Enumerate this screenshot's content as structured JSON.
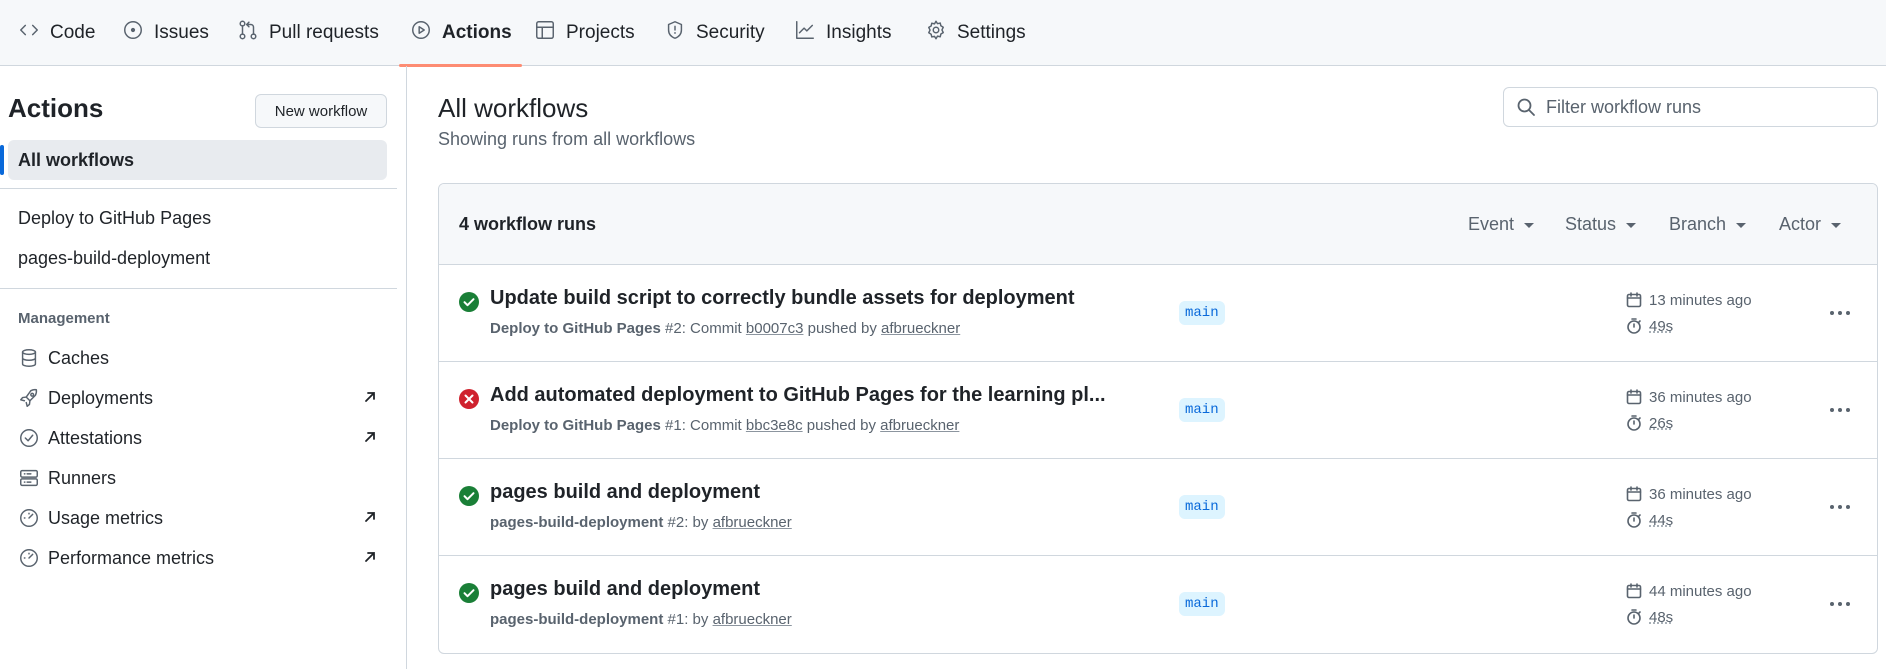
{
  "nav": {
    "tabs": [
      {
        "label": "Code",
        "icon": "code-icon"
      },
      {
        "label": "Issues",
        "icon": "issue-icon"
      },
      {
        "label": "Pull requests",
        "icon": "pull-request-icon"
      },
      {
        "label": "Actions",
        "icon": "play-icon",
        "active": true
      },
      {
        "label": "Projects",
        "icon": "table-icon"
      },
      {
        "label": "Security",
        "icon": "shield-icon"
      },
      {
        "label": "Insights",
        "icon": "graph-icon"
      },
      {
        "label": "Settings",
        "icon": "gear-icon"
      }
    ]
  },
  "sidebar": {
    "title": "Actions",
    "new_workflow_label": "New workflow",
    "all_workflows_label": "All workflows",
    "workflows": [
      "Deploy to GitHub Pages",
      "pages-build-deployment"
    ],
    "management_title": "Management",
    "management_items": [
      {
        "label": "Caches",
        "icon": "database-icon",
        "external": false
      },
      {
        "label": "Deployments",
        "icon": "rocket-icon",
        "external": true
      },
      {
        "label": "Attestations",
        "icon": "verified-icon",
        "external": true
      },
      {
        "label": "Runners",
        "icon": "server-icon",
        "external": false
      },
      {
        "label": "Usage metrics",
        "icon": "meter-icon",
        "external": true
      },
      {
        "label": "Performance metrics",
        "icon": "meter-icon",
        "external": true
      }
    ]
  },
  "main": {
    "title": "All workflows",
    "subtitle": "Showing runs from all workflows",
    "filter_placeholder": "Filter workflow runs",
    "runs_count": "4 workflow runs",
    "filters": [
      "Event",
      "Status",
      "Branch",
      "Actor"
    ],
    "runs": [
      {
        "status": "success",
        "title": "Update build script to correctly bundle assets for deployment",
        "workflow": "Deploy to GitHub Pages",
        "number": "#2",
        "commit_prefix": ": Commit ",
        "commit": "b0007c3",
        "pushed_by": " pushed by ",
        "actor": "afbrueckner",
        "branch": "main",
        "when": "13 minutes ago",
        "duration": "49s"
      },
      {
        "status": "failure",
        "title": "Add automated deployment to GitHub Pages for the learning pl...",
        "workflow": "Deploy to GitHub Pages",
        "number": "#1",
        "commit_prefix": ": Commit ",
        "commit": "bbc3e8c",
        "pushed_by": " pushed by ",
        "actor": "afbrueckner",
        "branch": "main",
        "when": "36 minutes ago",
        "duration": "26s"
      },
      {
        "status": "success",
        "title": "pages build and deployment",
        "workflow": "pages-build-deployment",
        "number": "#2",
        "by": ": by ",
        "actor": "afbrueckner",
        "branch": "main",
        "when": "36 minutes ago",
        "duration": "44s"
      },
      {
        "status": "success",
        "title": "pages build and deployment",
        "workflow": "pages-build-deployment",
        "number": "#1",
        "by": ": by ",
        "actor": "afbrueckner",
        "branch": "main",
        "when": "44 minutes ago",
        "duration": "48s"
      }
    ]
  },
  "colors": {
    "success": "#1a7f37",
    "failure": "#cf222e",
    "accent": "#0969da",
    "active_tab_underline": "#fd8c73"
  }
}
